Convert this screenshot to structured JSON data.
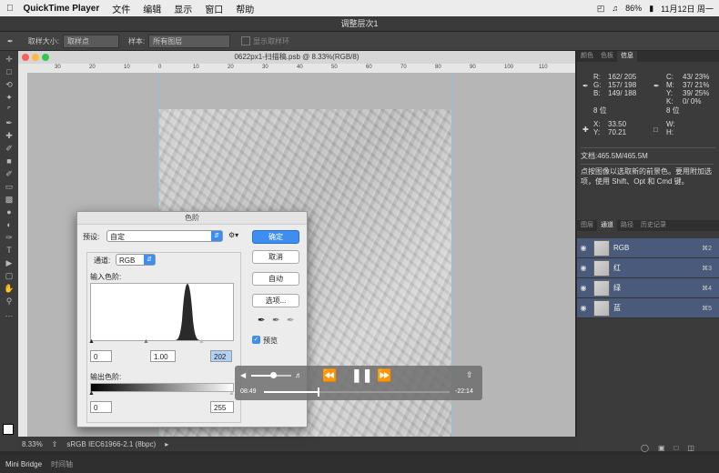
{
  "menubar": {
    "app": "QuickTime Player",
    "items": [
      "文件",
      "编辑",
      "显示",
      "窗口",
      "帮助"
    ],
    "battery": "86%",
    "date": "11月12日 周一"
  },
  "window_title": "调整层次1",
  "options_bar": {
    "sample_size_label": "取样大小:",
    "sample_size_value": "取样点",
    "sample_label": "样本:",
    "sample_value": "所有图层",
    "show_ring": "显示取样环"
  },
  "document": {
    "title": "0622px1-扫描稿.psb @ 8.33%(RGB/8)",
    "ruler_ticks": [
      "30",
      "20",
      "10",
      "0",
      "10",
      "20",
      "30",
      "40",
      "50",
      "60",
      "70",
      "80",
      "90",
      "100",
      "110"
    ],
    "zoom": "8.33%",
    "profile": "sRGB IEC61966-2.1 (8bpc)"
  },
  "bottom_tabs": [
    "Mini Bridge",
    "时间轴"
  ],
  "info_panel": {
    "tabs": [
      "颜色",
      "色板",
      "信息"
    ],
    "rgb": {
      "R": "162/ 205",
      "G": "157/ 198",
      "B": "149/ 188"
    },
    "cmyk": {
      "C": "43/ 23%",
      "M": "37/ 21%",
      "Y": "39/ 25%",
      "K": "0/ 0%"
    },
    "bits_left": "8 位",
    "bits_right": "8 位",
    "x": "33.50",
    "y": "70.21",
    "w": "",
    "h": "",
    "doc_size": "文档:465.5M/465.5M",
    "hint": "点按图像以选取新的前景色。要用附加选项，使用 Shift、Opt 和 Cmd 键。"
  },
  "layers_panel": {
    "tabs": [
      "图层",
      "通道",
      "路径",
      "历史记录"
    ],
    "channels": [
      {
        "name": "RGB",
        "shortcut": "⌘2"
      },
      {
        "name": "红",
        "shortcut": "⌘3"
      },
      {
        "name": "绿",
        "shortcut": "⌘4"
      },
      {
        "name": "蓝",
        "shortcut": "⌘5"
      }
    ]
  },
  "levels_dialog": {
    "title": "色阶",
    "preset_label": "预设:",
    "preset_value": "自定",
    "channel_label": "通道:",
    "channel_value": "RGB",
    "input_label": "输入色阶:",
    "input_values": [
      "0",
      "1.00",
      "202"
    ],
    "output_label": "输出色阶:",
    "output_values": [
      "0",
      "255"
    ],
    "buttons": {
      "ok": "确定",
      "cancel": "取消",
      "auto": "自动",
      "options": "选项..."
    },
    "preview_label": "预览",
    "preview_checked": true
  },
  "video": {
    "elapsed": "08:49",
    "remaining": "-22:14",
    "progress": 0.29,
    "volume": 0.55
  }
}
